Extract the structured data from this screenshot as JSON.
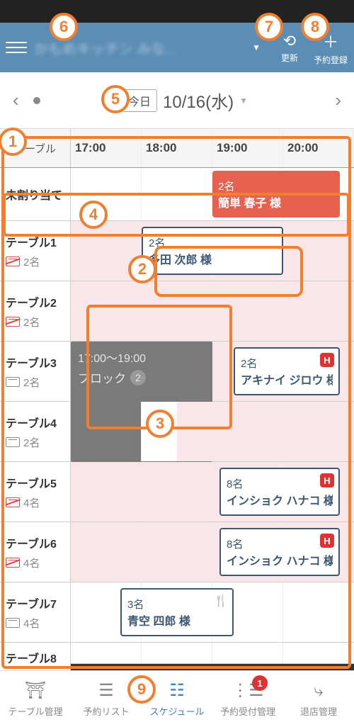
{
  "header": {
    "store_name": "かもめキッチン みな...",
    "refresh_label": "更新",
    "register_label": "予約登録"
  },
  "date_nav": {
    "today_label": "今日",
    "date_text": "10/16(水)"
  },
  "schedule": {
    "tables_header": "テーブル",
    "time_slots": [
      "17:00",
      "18:00",
      "19:00",
      "20:00"
    ],
    "rows": [
      {
        "title": "未割り当て",
        "capacity": ""
      },
      {
        "title": "テーブル1",
        "capacity": "2名"
      },
      {
        "title": "テーブル2",
        "capacity": "2名"
      },
      {
        "title": "テーブル3",
        "capacity": "2名"
      },
      {
        "title": "テーブル4",
        "capacity": "2名"
      },
      {
        "title": "テーブル5",
        "capacity": "4名"
      },
      {
        "title": "テーブル6",
        "capacity": "4名"
      },
      {
        "title": "テーブル7",
        "capacity": "4名"
      },
      {
        "title": "テーブル8",
        "capacity": ""
      }
    ],
    "bookings": {
      "unassigned": {
        "count": "2名",
        "name": "簡単 春子 様"
      },
      "t1": {
        "count": "2名",
        "name": "多田 次郎 様"
      },
      "t3": {
        "count": "2名",
        "name": "アキナイ ジロウ 様"
      },
      "t5": {
        "count": "8名",
        "name": "インショク ハナコ 様"
      },
      "t6": {
        "count": "8名",
        "name": "インショク ハナコ 様"
      },
      "t7": {
        "count": "3名",
        "name": "青空 四郎 様"
      }
    },
    "block": {
      "time": "17:00～19:00",
      "label": "ブロック",
      "count": "2"
    }
  },
  "bottom_nav": {
    "items": [
      {
        "label": "テーブル管理"
      },
      {
        "label": "予約リスト"
      },
      {
        "label": "スケジュール"
      },
      {
        "label": "予約受付管理"
      },
      {
        "label": "退店管理"
      }
    ],
    "badge": "1"
  },
  "callouts": [
    "1",
    "2",
    "3",
    "4",
    "5",
    "6",
    "7",
    "8",
    "9"
  ]
}
